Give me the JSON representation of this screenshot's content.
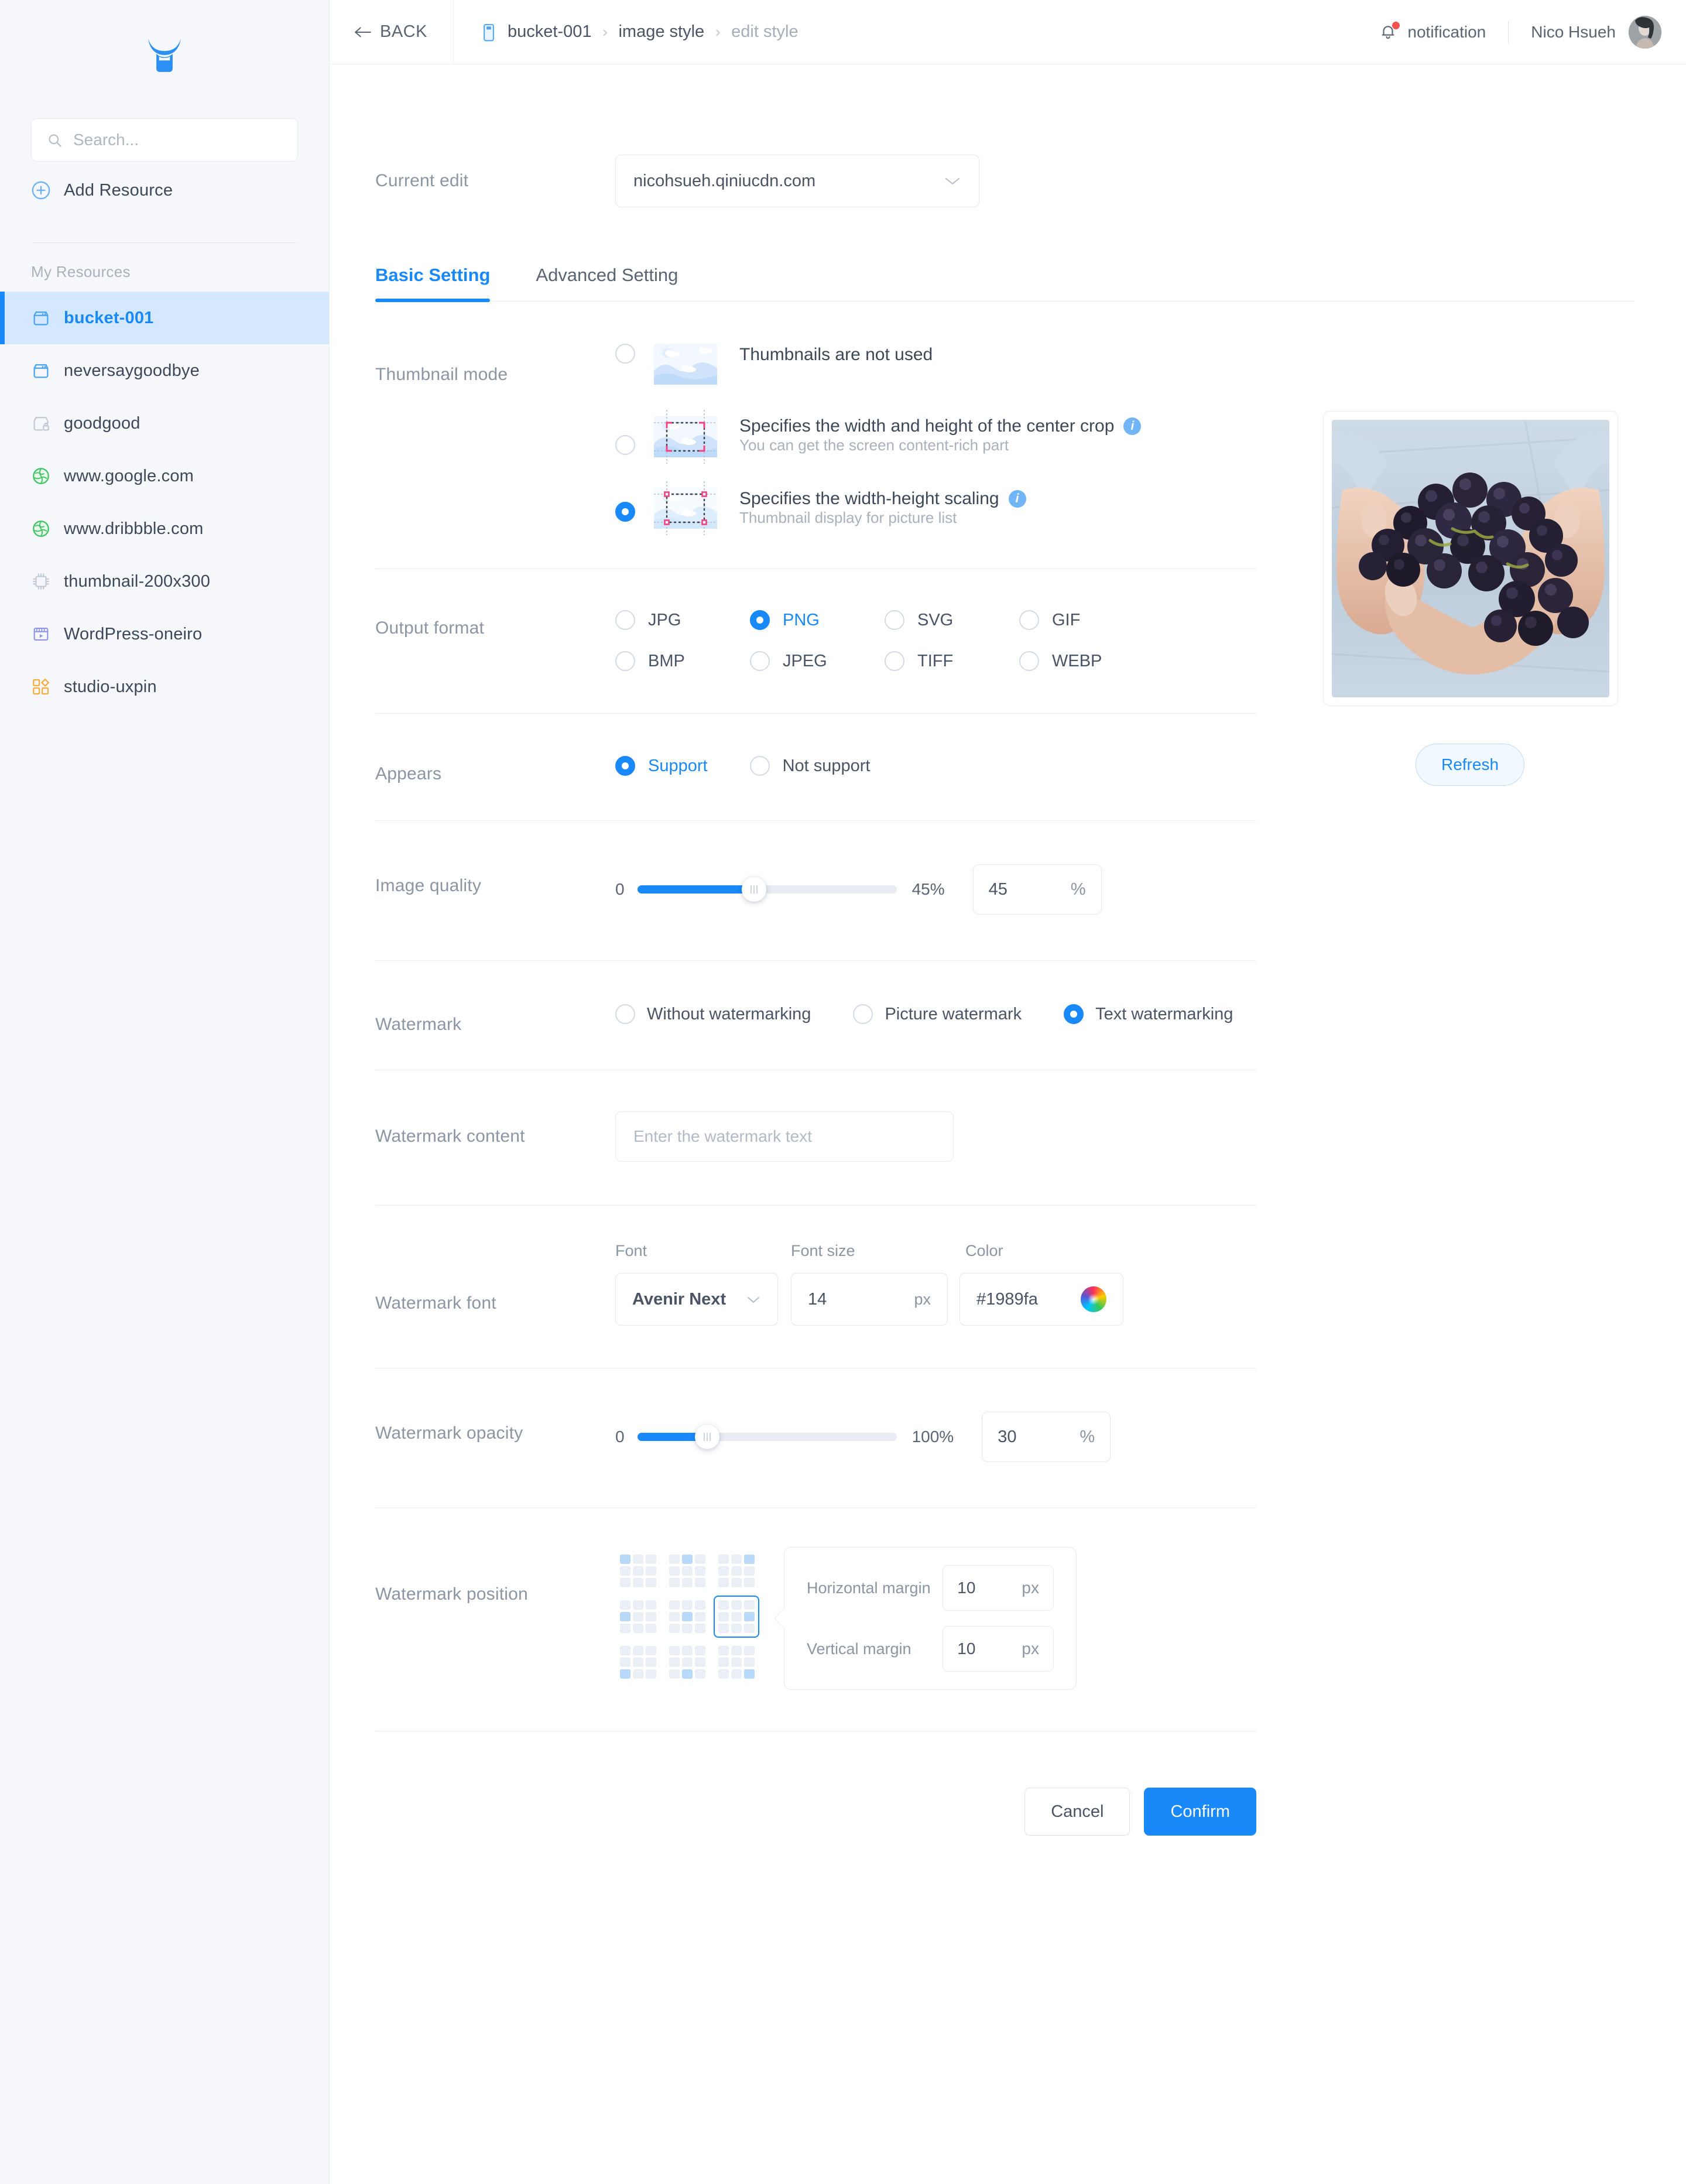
{
  "sidebar": {
    "logo_name": "niu-logo",
    "search": {
      "placeholder": "Search...",
      "value": ""
    },
    "add_resource_label": "Add Resource",
    "section_label": "My Resources",
    "items": [
      {
        "label": "bucket-001",
        "icon": "bucket-icon",
        "active": true
      },
      {
        "label": "neversaygoodbye",
        "icon": "bucket-icon",
        "active": false
      },
      {
        "label": "goodgood",
        "icon": "bucket-locked-icon",
        "active": false
      },
      {
        "label": "www.google.com",
        "icon": "globe-icon",
        "active": false
      },
      {
        "label": "www.dribbble.com",
        "icon": "globe-icon",
        "active": false
      },
      {
        "label": "thumbnail-200x300",
        "icon": "chip-icon",
        "active": false
      },
      {
        "label": "WordPress-oneiro",
        "icon": "media-icon",
        "active": false
      },
      {
        "label": "studio-uxpin",
        "icon": "apps-icon",
        "active": false
      }
    ]
  },
  "topbar": {
    "back_label": "BACK",
    "back_icon": "arrow-left-icon",
    "breadcrumb": [
      {
        "label": "bucket-001",
        "muted": false
      },
      {
        "label": "image style",
        "muted": false
      },
      {
        "label": "edit style",
        "muted": true
      }
    ],
    "breadcrumb_separator": "›",
    "notification_label": "notification",
    "notification_icon": "bell-icon",
    "username": "Nico Hsueh"
  },
  "form": {
    "current_edit": {
      "label": "Current edit",
      "value": "nicohsueh.qiniucdn.com"
    },
    "tabs": [
      {
        "label": "Basic Setting",
        "active": true
      },
      {
        "label": "Advanced Setting",
        "active": false
      }
    ],
    "thumbnail_mode": {
      "label": "Thumbnail mode",
      "options": [
        {
          "title": "Thumbnails are not used",
          "sub": "",
          "selected": false,
          "info": false
        },
        {
          "title": "Specifies the width and height of the center crop",
          "sub": "You can get the screen content-rich part",
          "selected": false,
          "info": true
        },
        {
          "title": "Specifies the width-height scaling",
          "sub": "Thumbnail display for picture list",
          "selected": true,
          "info": true
        }
      ]
    },
    "output_format": {
      "label": "Output format",
      "options": [
        {
          "label": "JPG",
          "selected": false
        },
        {
          "label": "PNG",
          "selected": true
        },
        {
          "label": "SVG",
          "selected": false
        },
        {
          "label": "GIF",
          "selected": false
        },
        {
          "label": "BMP",
          "selected": false
        },
        {
          "label": "JPEG",
          "selected": false
        },
        {
          "label": "TIFF",
          "selected": false
        },
        {
          "label": "WEBP",
          "selected": false
        }
      ]
    },
    "appears": {
      "label": "Appears",
      "options": [
        {
          "label": "Support",
          "selected": true
        },
        {
          "label": "Not support",
          "selected": false
        }
      ]
    },
    "image_quality": {
      "label": "Image quality",
      "min_label": "0",
      "max_label": "45%",
      "value": "45",
      "unit": "%",
      "percent": 45
    },
    "watermark": {
      "label": "Watermark",
      "options": [
        {
          "label": "Without watermarking",
          "selected": false
        },
        {
          "label": "Picture watermark",
          "selected": false
        },
        {
          "label": "Text watermarking",
          "selected": true
        }
      ]
    },
    "watermark_content": {
      "label": "Watermark content",
      "placeholder": "Enter the watermark text",
      "value": ""
    },
    "watermark_font": {
      "label": "Watermark font",
      "font_head": "Font",
      "size_head": "Font size",
      "color_head": "Color",
      "font_value": "Avenir Next",
      "size_value": "14",
      "size_unit": "px",
      "color_value": "#1989fa"
    },
    "watermark_opacity": {
      "label": "Watermark opacity",
      "min_label": "0",
      "max_label": "100%",
      "value": "30",
      "unit": "%",
      "percent": 27
    },
    "watermark_position": {
      "label": "Watermark position",
      "selected_index": 5,
      "horizontal_label": "Horizontal margin",
      "horizontal_value": "10",
      "horizontal_unit": "px",
      "vertical_label": "Vertical margin",
      "vertical_value": "10",
      "vertical_unit": "px"
    },
    "cancel_label": "Cancel",
    "confirm_label": "Confirm"
  },
  "preview": {
    "refresh_label": "Refresh",
    "image_alt": "hands-holding-grapes"
  },
  "colors": {
    "accent": "#1989fa",
    "label_text": "#8b95a3",
    "body_text": "#4a5464",
    "sidebar_bg": "#f5f7fa",
    "active_item_bg": "#d4e9ff",
    "notification_dot": "#f5524c"
  }
}
